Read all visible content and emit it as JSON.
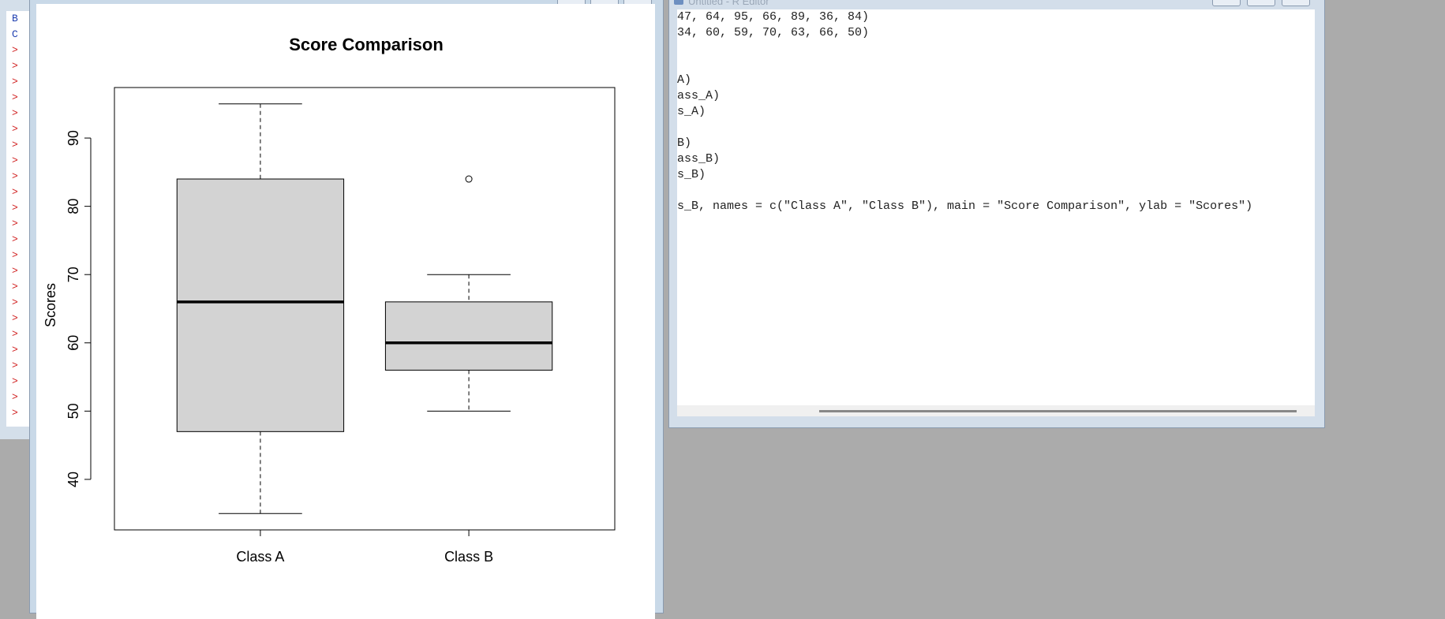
{
  "console": {
    "lines": [
      {
        "text": "B",
        "kind": "out"
      },
      {
        "text": "C",
        "kind": "out"
      },
      {
        "text": ">",
        "kind": "prompt"
      },
      {
        "text": ">",
        "kind": "prompt"
      },
      {
        "text": ">",
        "kind": "prompt"
      },
      {
        "text": ">",
        "kind": "prompt"
      },
      {
        "text": ">",
        "kind": "prompt"
      },
      {
        "text": ">",
        "kind": "prompt"
      },
      {
        "text": ">",
        "kind": "prompt"
      },
      {
        "text": ">",
        "kind": "prompt"
      },
      {
        "text": ">",
        "kind": "prompt"
      },
      {
        "text": ">",
        "kind": "prompt"
      },
      {
        "text": ">",
        "kind": "prompt"
      },
      {
        "text": ">",
        "kind": "prompt"
      },
      {
        "text": ">",
        "kind": "prompt"
      },
      {
        "text": ">",
        "kind": "prompt"
      },
      {
        "text": ">",
        "kind": "prompt"
      },
      {
        "text": ">",
        "kind": "prompt"
      },
      {
        "text": ">",
        "kind": "prompt"
      },
      {
        "text": ">",
        "kind": "prompt"
      },
      {
        "text": ">",
        "kind": "prompt"
      },
      {
        "text": ">",
        "kind": "prompt"
      },
      {
        "text": ">",
        "kind": "prompt"
      },
      {
        "text": ">",
        "kind": "prompt"
      },
      {
        "text": ">",
        "kind": "prompt"
      },
      {
        "text": ">",
        "kind": "prompt"
      }
    ]
  },
  "editor": {
    "title": "Untitled - R Editor",
    "lines": [
      "47, 64, 95, 66, 89, 36, 84)",
      "34, 60, 59, 70, 63, 66, 50)",
      "",
      "",
      "A)",
      "ass_A)",
      "s_A)",
      "",
      "B)",
      "ass_B)",
      "s_B)",
      "",
      "s_B, names = c(\"Class A\", \"Class B\"), main = \"Score Comparison\", ylab = \"Scores\")"
    ]
  },
  "chart_data": {
    "type": "boxplot",
    "title": "Score Comparison",
    "ylabel": "Scores",
    "xlabel": "",
    "ylim": [
      32.6,
      97.4
    ],
    "yticks": [
      40,
      50,
      60,
      70,
      80,
      90
    ],
    "categories": [
      "Class A",
      "Class B"
    ],
    "boxes": [
      {
        "name": "Class A",
        "min": 35,
        "q1": 47,
        "median": 66,
        "q3": 84,
        "max": 95,
        "outliers": []
      },
      {
        "name": "Class B",
        "min": 50,
        "q1": 56,
        "median": 60,
        "q3": 66,
        "max": 70,
        "outliers": [
          84
        ]
      }
    ],
    "fill": "#d3d3d3",
    "grid": false
  }
}
